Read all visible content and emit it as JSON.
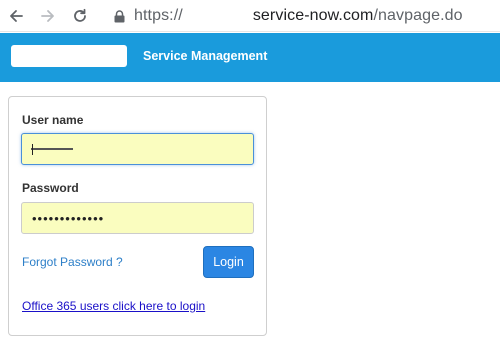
{
  "browser": {
    "back_icon": "arrow-left-icon",
    "forward_icon": "arrow-right-icon",
    "reload_icon": "reload-icon",
    "lock_icon": "lock-icon",
    "url_scheme": "https://",
    "url_domain": "service-now.com",
    "url_path": "/navpage.do"
  },
  "header": {
    "title": "Service Management",
    "background_color": "#1a9bdc"
  },
  "login": {
    "username_label": "User name",
    "password_label": "Password",
    "password_value": "•••••••••••••",
    "forgot_password_label": "Forgot Password ?",
    "login_button_label": "Login",
    "office365_link_label": "Office 365 users click here to login"
  }
}
